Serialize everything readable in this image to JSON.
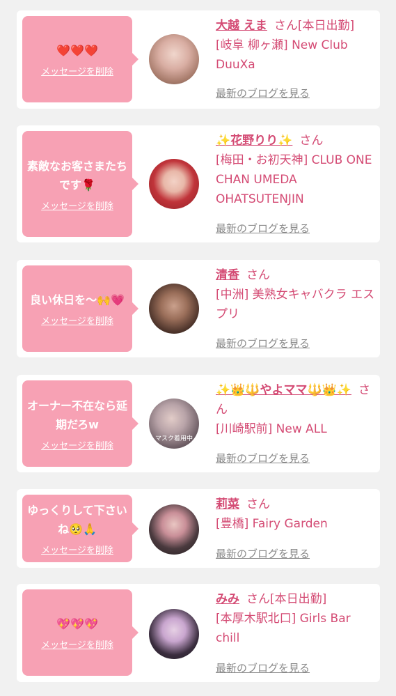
{
  "items": [
    {
      "message": "❤️❤️❤️",
      "delete_label": "メッセージを削除",
      "name": "大越 えま",
      "honorific": "さん[本日出勤]",
      "store": "[岐阜 柳ヶ瀬] New Club DuuXa",
      "blog_label": "最新のブログを見る",
      "avatar_color": "#c9a49a"
    },
    {
      "message": "素敵なお客さまたちです🌹",
      "delete_label": "メッセージを削除",
      "name": "✨花野りり✨",
      "honorific": "さん",
      "store": "[梅田・お初天神] CLUB ONE CHAN UMEDA OHATSUTENJIN",
      "blog_label": "最新のブログを見る",
      "avatar_color": "#c0343a"
    },
    {
      "message": "良い休日を〜🙌💗",
      "delete_label": "メッセージを削除",
      "name": "清香",
      "honorific": "さん",
      "store": "[中洲] 美熟女キャバクラ エスプリ",
      "blog_label": "最新のブログを見る",
      "avatar_color": "#6b4a3a"
    },
    {
      "message": "オーナー不在なら延期だろw",
      "delete_label": "メッセージを削除",
      "name": "✨👑🔱やよママ🔱👑✨",
      "honorific": "さん",
      "store": "[川崎駅前] New ALL",
      "blog_label": "最新のブログを見る",
      "avatar_color": "#8c7f86",
      "avatar_caption": "マスク着用中"
    },
    {
      "message": "ゆっくりして下さいね🥺🙏",
      "delete_label": "メッセージを削除",
      "name": "莉菜",
      "honorific": "さん",
      "store": "[豊橋] Fairy Garden",
      "blog_label": "最新のブログを見る",
      "avatar_color": "#3b3033"
    },
    {
      "message": "💖💖💖",
      "delete_label": "メッセージを削除",
      "name": "みみ",
      "honorific": "さん[本日出勤]",
      "store": "[本厚木駅北口] Girls Bar chill",
      "blog_label": "最新のブログを見る",
      "avatar_color": "#2c2430"
    }
  ]
}
